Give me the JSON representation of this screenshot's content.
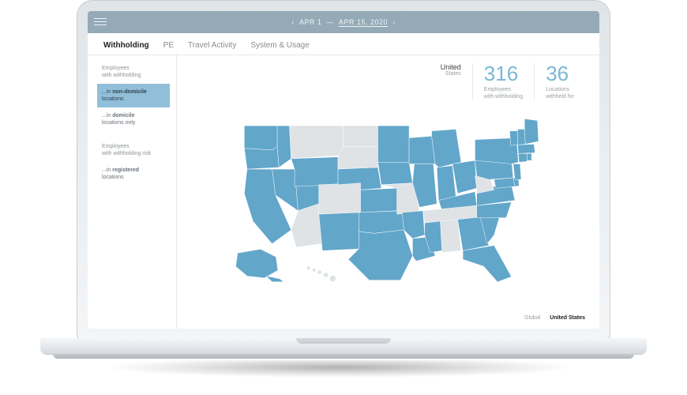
{
  "date_range": {
    "start": "APR 1",
    "end": "APR 15, 2020"
  },
  "tabs": [
    {
      "label": "Withholding",
      "active": true
    },
    {
      "label": "PE",
      "active": false
    },
    {
      "label": "Travel Activity",
      "active": false
    },
    {
      "label": "System & Usage",
      "active": false
    }
  ],
  "sidebar": {
    "group1": {
      "title_l1": "Employees",
      "title_l2": "with withholding",
      "items": [
        {
          "prefix": "...in ",
          "bold": "non-domicile",
          "suffix": " locations",
          "active": true
        },
        {
          "prefix": "...in ",
          "bold": "domicile",
          "suffix": " locations only",
          "active": false
        }
      ]
    },
    "group2": {
      "title_l1": "Employees",
      "title_l2": "with withholding risk",
      "items": [
        {
          "prefix": "...in ",
          "bold": "registered",
          "suffix": " locations",
          "active": false
        }
      ]
    }
  },
  "metrics": {
    "region_l1": "United",
    "region_l2": "States",
    "m1_value": "316",
    "m1_label_l1": "Employees",
    "m1_label_l2": "with withholding",
    "m2_value": "36",
    "m2_label_l1": "Locations",
    "m2_label_l2": "withheld for"
  },
  "view_toggle": {
    "global": "Global",
    "us": "United States"
  },
  "map": {
    "inactive_states": [
      "MT",
      "ND",
      "SD",
      "CO",
      "MO",
      "TN",
      "AL",
      "WV",
      "AZ",
      "HI"
    ]
  }
}
